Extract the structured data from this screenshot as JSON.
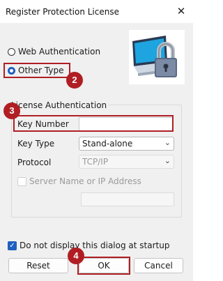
{
  "window": {
    "title": "Register Protection License",
    "close_glyph": "✕"
  },
  "auth": {
    "web_label": "Web Authentication",
    "other_label": "Other Type",
    "selected": "other"
  },
  "license": {
    "legend": "License Authentication",
    "key_number_label": "Key Number",
    "key_number_value": "",
    "key_type_label": "Key Type",
    "key_type_value": "Stand-alone",
    "protocol_label": "Protocol",
    "protocol_value": "TCP/IP",
    "server_label": "Server Name or IP Address",
    "server_checked": false,
    "server_value": ""
  },
  "startup": {
    "label": "Do not display this dialog at startup",
    "checked": true
  },
  "buttons": {
    "reset": "Reset",
    "ok": "OK",
    "cancel": "Cancel"
  },
  "callouts": [
    "2",
    "3",
    "4"
  ],
  "colors": {
    "accent": "#1f5fbf",
    "callout": "#b01e23"
  },
  "icons": {
    "license_graphic": "monitor-padlock-icon"
  }
}
